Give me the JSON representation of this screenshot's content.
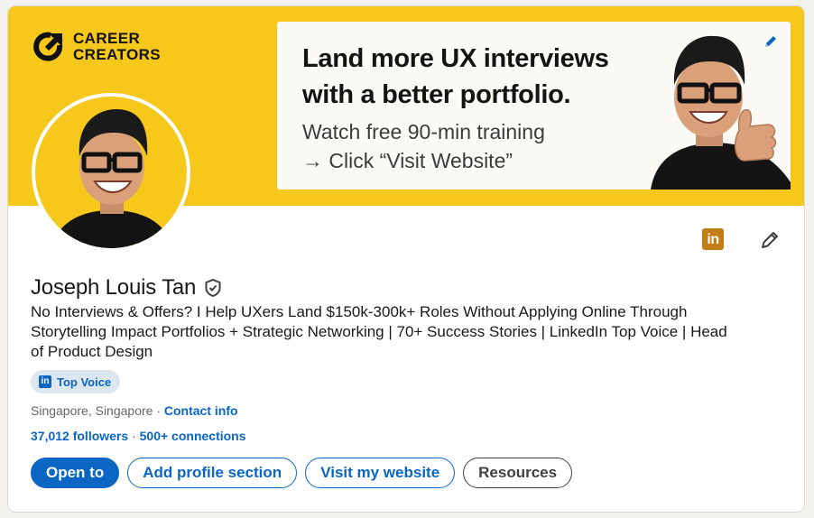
{
  "banner": {
    "brand": {
      "line1": "CAREER",
      "line2": "CREATORS",
      "icon": "career-creators-logo"
    },
    "promo": {
      "headline_line1": "Land more UX interviews",
      "headline_line2": "with a better portfolio.",
      "sub_line1": "Watch free 90-min training",
      "sub_line2": "→ Click “Visit Website”"
    },
    "background_color": "#f6c81b"
  },
  "profile": {
    "name": "Joseph Louis Tan",
    "headline_lines": [
      "No Interviews & Offers? I Help UXers Land $150k-300k+ Roles Without Applying Online Through",
      "Storytelling Impact Portfolios + Strategic Networking | 70+ Success Stories | LinkedIn Top Voice | Head",
      "of Product Design"
    ],
    "badge": {
      "logo": "in",
      "label": "Top Voice"
    },
    "location": "Singapore, Singapore",
    "separator": "·",
    "contact_info": "Contact info",
    "followers": "37,012 followers",
    "connections_sep": " · ",
    "connections": "500+ connections"
  },
  "icons": {
    "linkedin_glyph": "in"
  },
  "actions": {
    "open_to": "Open to",
    "add_profile_section": "Add profile section",
    "visit_website": "Visit my website",
    "resources": "Resources"
  },
  "colors": {
    "accent": "#0a66c2",
    "banner": "#f6c81b",
    "badge_bg": "#dde7f1",
    "linkedin_icon": "#c37d16"
  }
}
